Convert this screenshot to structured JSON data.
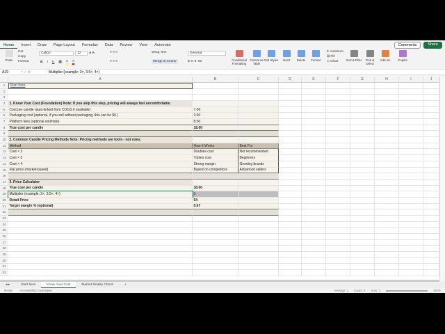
{
  "ribbon_tabs": [
    "Home",
    "Insert",
    "Draw",
    "Page Layout",
    "Formulas",
    "Data",
    "Review",
    "View",
    "Automate"
  ],
  "active_tab": "Home",
  "comments_label": "Comments",
  "share_label": "Share",
  "clipboard": {
    "paste": "Paste",
    "cut": "Cut",
    "copy": "Copy",
    "format": "Format"
  },
  "font": {
    "name": "Calibri",
    "size": "12"
  },
  "wrap_text": "Wrap Text",
  "merge_center": "Merge & Center",
  "number_format": "General",
  "big_buttons": [
    {
      "label": "Conditional Formatting",
      "color": "#c0392b"
    },
    {
      "label": "Format as Table",
      "color": "#3a7bd5"
    },
    {
      "label": "Cell Styles",
      "color": "#3a7bd5"
    },
    {
      "label": "Insert",
      "color": "#3a7bd5"
    },
    {
      "label": "Delete",
      "color": "#3a7bd5"
    },
    {
      "label": "Format",
      "color": "#3a7bd5"
    },
    {
      "label": "Sort & Filter",
      "color": "#555"
    },
    {
      "label": "Find & Select",
      "color": "#555"
    },
    {
      "label": "Add-ins",
      "color": "#d35400"
    },
    {
      "label": "Copilot",
      "color": "#8e44ad"
    }
  ],
  "editing": {
    "autosum": "AutoSum",
    "fill": "Fill",
    "clear": "Clear"
  },
  "formula_bar": {
    "name_box": "A19",
    "fx": "fx",
    "formula": "Multiplier (example: 3×, 3.5×, 4×)"
  },
  "columns": [
    "A",
    "B",
    "C",
    "D",
    "E",
    "F",
    "G",
    "H",
    "I",
    "J"
  ],
  "row_count": 32,
  "rows": {
    "1": [
      "Start here",
      "",
      ""
    ],
    "4": [
      "1. Know Your Cost (Foundation) Note: If you skip this step, pricing will always feel uncomfortable.",
      "",
      ""
    ],
    "5": [
      "Cost per candle (auto-linked from COGS if available)",
      "7.00",
      ""
    ],
    "6": [
      "Packaging cost (optional, if you sell without packaging, this can be $0.)",
      "3.00",
      ""
    ],
    "7": [
      "Platform fees (optional estimate)",
      "8.00",
      ""
    ],
    "8": [
      "True cost per candle",
      "18.00",
      ""
    ],
    "10": [
      "2. Common Candle Pricing Methods Note: Pricing methods are tools - not rules.",
      "",
      ""
    ],
    "11": [
      "Method",
      "How It Works",
      "Best For"
    ],
    "12": [
      "Cost × 2",
      "Doubles cost",
      "Not recommended"
    ],
    "13": [
      "Cost × 3",
      "Triples cost",
      "Beginners"
    ],
    "14": [
      "Cost × 4",
      "Strong margin",
      "Growing brands"
    ],
    "15": [
      "Flat price (market-based)",
      "Based on competitors",
      "Advanced sellers"
    ],
    "17": [
      "3. Price Calculator",
      "",
      ""
    ],
    "18": [
      "True cost per candle",
      "18.00",
      ""
    ],
    "19": [
      "Multiplier (example: 3×, 3.5×, 4×)",
      "3",
      ""
    ],
    "20": [
      "Retail Price",
      "54",
      ""
    ],
    "21": [
      "Target margin % (optional)",
      "0.67",
      ""
    ]
  },
  "sheet_tabs": [
    "Start here",
    "Know Your Cost",
    "Market Reality Check"
  ],
  "active_sheet": "Know Your Cost",
  "add_sheet": "+",
  "status": {
    "ready": "Ready",
    "accessibility": "Accessibility: Investigate",
    "average": "Average: 3",
    "count": "Count: 2",
    "sum": "Sum: 3",
    "zoom": "161%"
  }
}
